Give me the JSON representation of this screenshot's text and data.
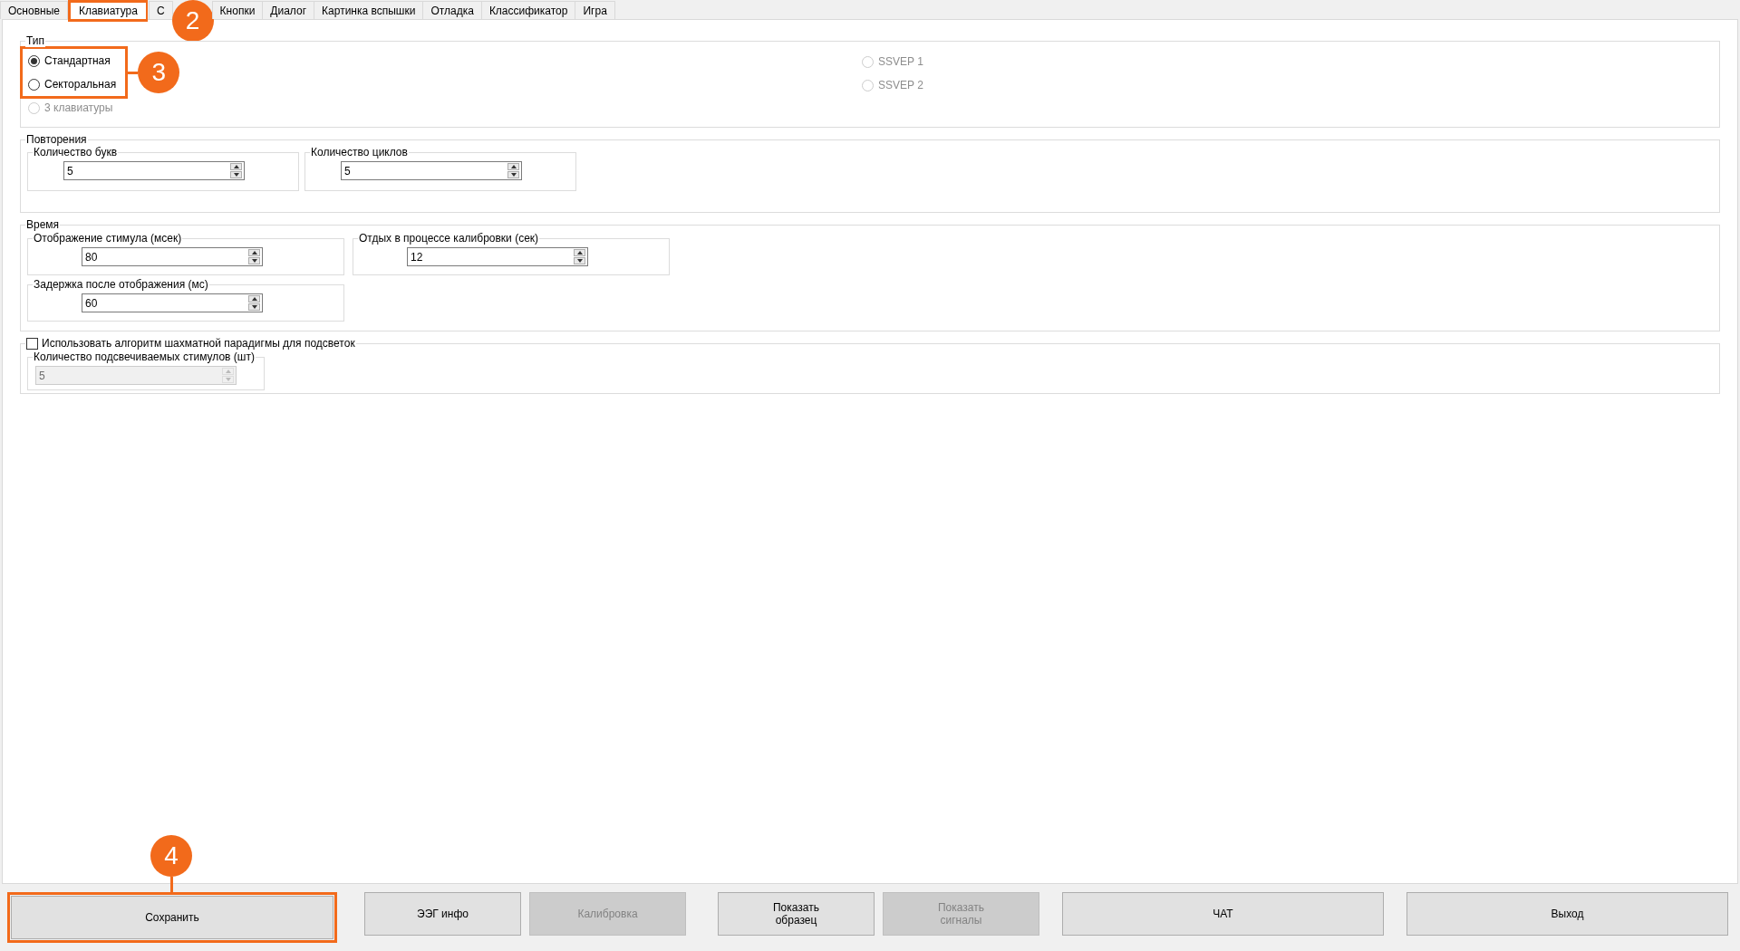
{
  "tabs": [
    {
      "label": "Основные",
      "selected": false
    },
    {
      "label": "Клавиатура",
      "selected": true
    },
    {
      "label": "С",
      "selected": false
    },
    {
      "label": "Кнопки",
      "selected": false
    },
    {
      "label": "Диалог",
      "selected": false
    },
    {
      "label": "Картинка вспышки",
      "selected": false
    },
    {
      "label": "Отладка",
      "selected": false
    },
    {
      "label": "Классификатор",
      "selected": false
    },
    {
      "label": "Игра",
      "selected": false
    }
  ],
  "type_group": {
    "title": "Тип",
    "columns": [
      [
        {
          "label": "Стандартная",
          "selected": true,
          "disabled": false
        },
        {
          "label": "Секторальная",
          "selected": false,
          "disabled": false
        },
        {
          "label": "3 клавиатуры",
          "selected": false,
          "disabled": true
        }
      ],
      [
        {
          "label": "SSVEP 1",
          "selected": false,
          "disabled": true
        },
        {
          "label": "SSVEP 2",
          "selected": false,
          "disabled": true
        }
      ]
    ]
  },
  "repeats": {
    "title": "Повторения",
    "fields": [
      {
        "label": "Количество букв",
        "value": "5",
        "disabled": false
      },
      {
        "label": "Количество циклов",
        "value": "5",
        "disabled": false
      }
    ]
  },
  "timing": {
    "title": "Время",
    "fields": [
      {
        "label": "Отображение стимула (мсек)",
        "value": "80",
        "disabled": false
      },
      {
        "label": "Отдых в процессе калибровки (сек)",
        "value": "12",
        "disabled": false
      },
      {
        "label": "Задержка после отображения (мс)",
        "value": "60",
        "disabled": false
      }
    ]
  },
  "chess": {
    "checkbox": {
      "label": "Использовать алгоритм шахматной парадигмы для подсветок",
      "checked": false
    },
    "field": {
      "label": "Количество подсвечиваемых стимулов (шт)",
      "value": "5",
      "disabled": true
    }
  },
  "buttons": [
    {
      "label": "Сохранить",
      "disabled": false
    },
    {
      "label": "ЭЭГ инфо",
      "disabled": false
    },
    {
      "label": "Калибровка",
      "disabled": true
    },
    {
      "label": "Показать\nобразец",
      "disabled": false
    },
    {
      "label": "Показать\nсигналы",
      "disabled": true
    },
    {
      "label": "ЧАТ",
      "disabled": false
    },
    {
      "label": "Выход",
      "disabled": false
    }
  ],
  "callouts": [
    {
      "number": "2"
    },
    {
      "number": "3"
    },
    {
      "number": "4"
    }
  ]
}
